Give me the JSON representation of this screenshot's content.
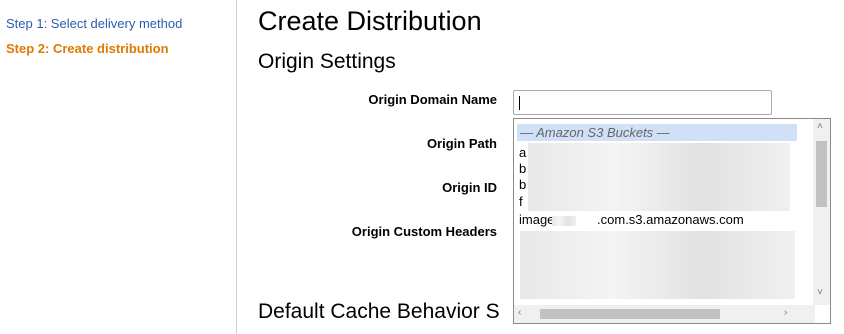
{
  "sidebar": {
    "steps": [
      {
        "label": "Step 1: Select delivery method"
      },
      {
        "label": "Step 2: Create distribution"
      }
    ]
  },
  "main": {
    "title": "Create Distribution",
    "section": "Origin Settings",
    "next_section": "Default Cache Behavior S",
    "labels": {
      "domain": "Origin Domain Name",
      "path": "Origin Path",
      "id": "Origin ID",
      "headers": "Origin Custom Headers"
    },
    "domain_value": ""
  },
  "dropdown": {
    "group_label": "— Amazon S3 Buckets —",
    "options": [
      "a",
      "b",
      "b",
      "f",
      "image.   .com.s3.amazonaws.com"
    ]
  },
  "icons": {
    "scroll_up": "chevron-up-icon",
    "scroll_down": "chevron-down-icon",
    "scroll_left": "chevron-left-icon",
    "scroll_right": "chevron-right-icon"
  }
}
